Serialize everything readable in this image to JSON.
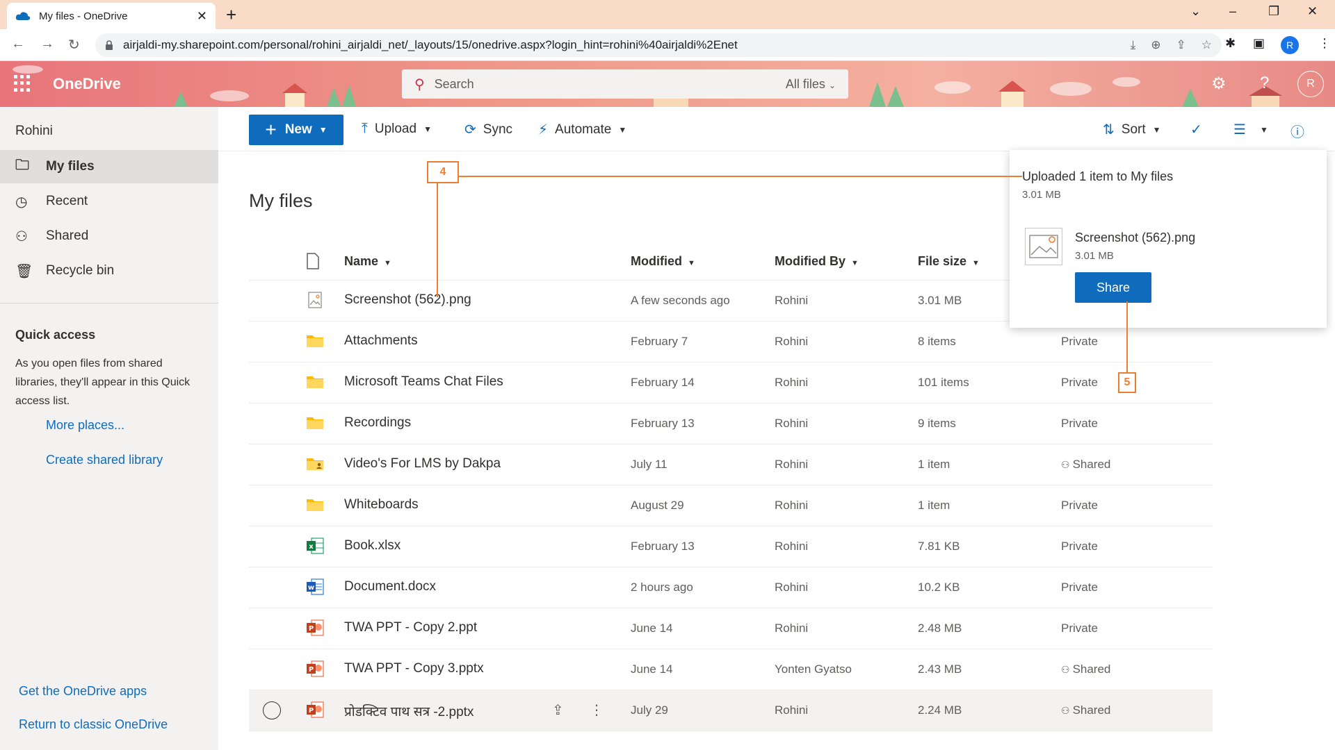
{
  "browser": {
    "tab_title": "My files - OneDrive",
    "tab_close": "✕",
    "new_tab": "+",
    "url": "airjaldi-my.sharepoint.com/personal/rohini_airjaldi_net/_layouts/15/onedrive.aspx?login_hint=rohini%40airjaldi%2Enet",
    "profile_initial": "R"
  },
  "header": {
    "brand": "OneDrive",
    "search_placeholder": "Search",
    "search_scope": "All files",
    "avatar_initial": "R"
  },
  "sidebar": {
    "user": "Rohini",
    "items": [
      {
        "label": "My files",
        "icon": "folder-icon",
        "active": true
      },
      {
        "label": "Recent",
        "icon": "clock-icon",
        "active": false
      },
      {
        "label": "Shared",
        "icon": "people-icon",
        "active": false
      },
      {
        "label": "Recycle bin",
        "icon": "trash-icon",
        "active": false
      }
    ],
    "quick_access_title": "Quick access",
    "quick_access_desc": "As you open files from shared libraries, they'll appear in this Quick access list.",
    "more_places": "More places...",
    "create_library": "Create shared library",
    "get_apps": "Get the OneDrive apps",
    "return_classic": "Return to classic OneDrive"
  },
  "commandbar": {
    "new": "New",
    "upload": "Upload",
    "sync": "Sync",
    "automate": "Automate",
    "sort": "Sort"
  },
  "main": {
    "title": "My files",
    "columns": {
      "name": "Name",
      "modified": "Modified",
      "modified_by": "Modified By",
      "file_size": "File size"
    },
    "rows": [
      {
        "name": "Screenshot (562).png",
        "type": "image",
        "modified": "A few seconds ago",
        "by": "Rohini",
        "size": "3.01 MB",
        "sharing": ""
      },
      {
        "name": "Attachments",
        "type": "folder",
        "modified": "February 7",
        "by": "Rohini",
        "size": "8 items",
        "sharing": "Private"
      },
      {
        "name": "Microsoft Teams Chat Files",
        "type": "folder",
        "modified": "February 14",
        "by": "Rohini",
        "size": "101 items",
        "sharing": "Private"
      },
      {
        "name": "Recordings",
        "type": "folder",
        "modified": "February 13",
        "by": "Rohini",
        "size": "9 items",
        "sharing": "Private"
      },
      {
        "name": "Video's For LMS by Dakpa",
        "type": "shared-folder",
        "modified": "July 11",
        "by": "Rohini",
        "size": "1 item",
        "sharing": "Shared"
      },
      {
        "name": "Whiteboards",
        "type": "folder",
        "modified": "August 29",
        "by": "Rohini",
        "size": "1 item",
        "sharing": "Private"
      },
      {
        "name": "Book.xlsx",
        "type": "excel",
        "modified": "February 13",
        "by": "Rohini",
        "size": "7.81 KB",
        "sharing": "Private"
      },
      {
        "name": "Document.docx",
        "type": "word",
        "modified": "2 hours ago",
        "by": "Rohini",
        "size": "10.2 KB",
        "sharing": "Private"
      },
      {
        "name": "TWA PPT - Copy 2.ppt",
        "type": "powerpoint",
        "modified": "June 14",
        "by": "Rohini",
        "size": "2.48 MB",
        "sharing": "Private"
      },
      {
        "name": "TWA PPT - Copy 3.pptx",
        "type": "powerpoint",
        "modified": "June 14",
        "by": "Yonten Gyatso",
        "size": "2.43 MB",
        "sharing": "Shared"
      },
      {
        "name": "प्रोडक्टिव पाथ सत्र -2.pptx",
        "type": "powerpoint",
        "modified": "July 29",
        "by": "Rohini",
        "size": "2.24 MB",
        "sharing": "Shared"
      }
    ]
  },
  "flyout": {
    "title": "Uploaded 1 item to My files",
    "subtitle": "3.01 MB",
    "file_name": "Screenshot (562).png",
    "file_size": "3.01 MB",
    "share": "Share"
  },
  "annotations": {
    "step4": "4",
    "step5": "5"
  },
  "colors": {
    "accent": "#0f6cbd",
    "annotation": "#ed7d31",
    "header_start": "#e8757a"
  }
}
